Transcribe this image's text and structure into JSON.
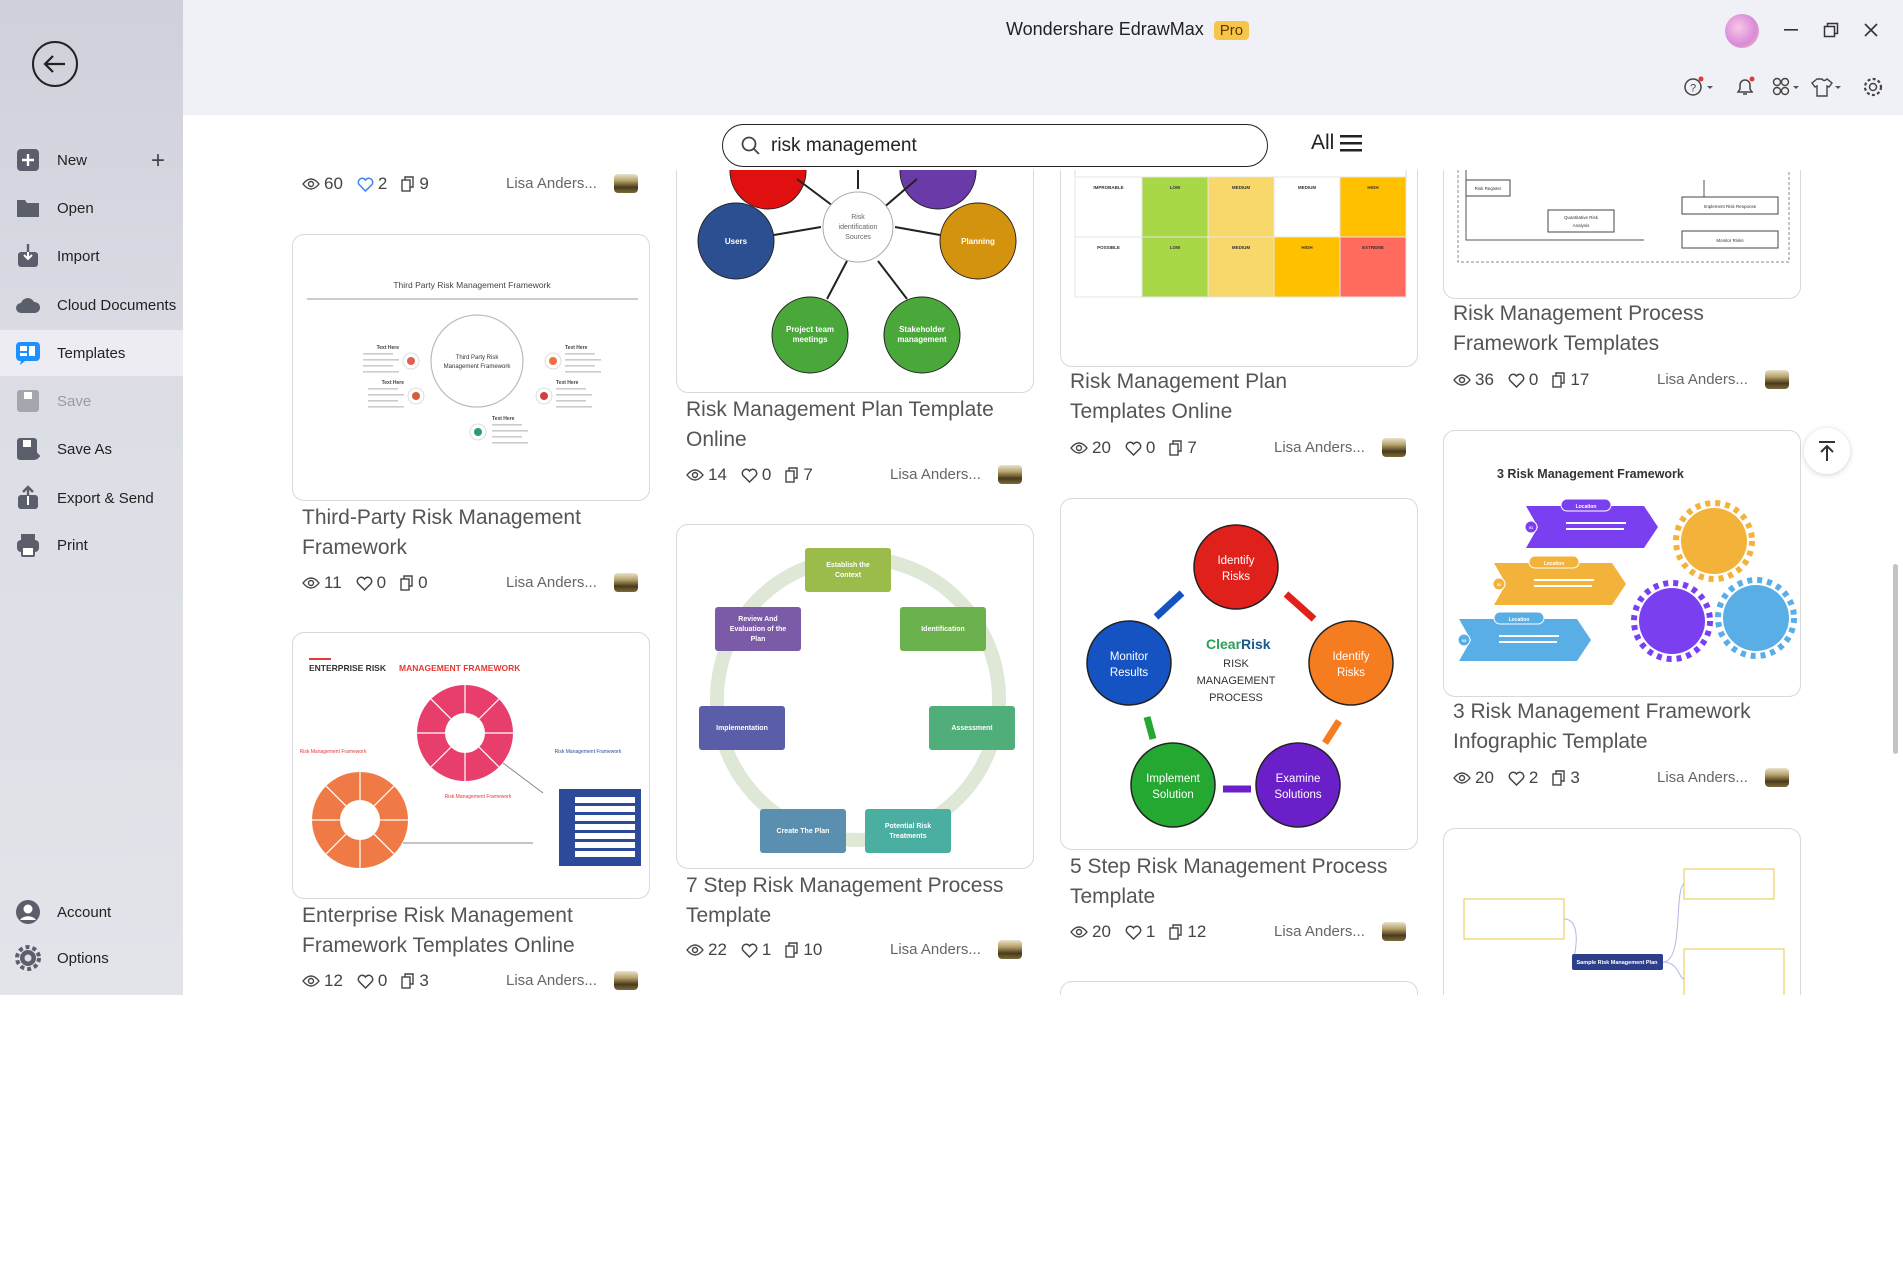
{
  "app": {
    "title": "Wondershare EdrawMax",
    "badge": "Pro"
  },
  "header_icons": [
    "avatar",
    "minimize-icon",
    "restore-icon",
    "close-icon",
    "help-icon",
    "bell-icon",
    "apps-icon",
    "shirt-icon",
    "gear-icon"
  ],
  "sidebar": {
    "items": [
      {
        "label": "New",
        "icon": "plus-square-icon"
      },
      {
        "label": "Open",
        "icon": "folder-icon"
      },
      {
        "label": "Import",
        "icon": "import-icon"
      },
      {
        "label": "Cloud Documents",
        "icon": "cloud-icon"
      },
      {
        "label": "Templates",
        "icon": "templates-icon",
        "selected": true
      },
      {
        "label": "Save",
        "icon": "save-icon",
        "disabled": true
      },
      {
        "label": "Save As",
        "icon": "save-as-icon"
      },
      {
        "label": "Export & Send",
        "icon": "export-icon"
      },
      {
        "label": "Print",
        "icon": "print-icon"
      }
    ],
    "bottom": [
      {
        "label": "Account",
        "icon": "account-icon"
      },
      {
        "label": "Options",
        "icon": "options-gear-icon"
      }
    ]
  },
  "search": {
    "value": "risk management",
    "filter_label": "All"
  },
  "colors": {
    "liked": "#3b82f6",
    "accent_badge": "#f7c54a"
  },
  "cards": [
    {
      "title_lines": [],
      "views": "60",
      "likes": "2",
      "liked": true,
      "copies": "9",
      "author": "Lisa Anders..."
    },
    {
      "title_lines": [
        "Third-Party Risk Management",
        "Framework"
      ],
      "views": "11",
      "likes": "0",
      "copies": "0",
      "author": "Lisa Anders...",
      "thumb_text": {
        "heading": "Third Party Risk Management Framework",
        "center1": "Third Party Risk",
        "center2": "Management Framework",
        "item": "Text Here"
      }
    },
    {
      "title_lines": [
        "Enterprise Risk Management",
        "Framework Templates Online"
      ],
      "views": "12",
      "likes": "0",
      "copies": "3",
      "author": "Lisa Anders...",
      "thumb_text": {
        "heading_a": "ENTERPRISE RISK ",
        "heading_b": "MANAGEMENT FRAMEWORK",
        "left": "Risk Management Framework",
        "mid": "Risk Management Framework",
        "right": "Risk Management Framework"
      }
    },
    {
      "title_lines": [
        "Risk Management Plan Template",
        "Online"
      ],
      "views": "14",
      "likes": "0",
      "copies": "7",
      "author": "Lisa Anders...",
      "thumb_text": {
        "center1": "Risk",
        "center2": "identification",
        "center3": "Sources",
        "users": "Users",
        "planning": "Planning",
        "team1": "Project team",
        "team2": "meetings",
        "stake1": "Stakeholder",
        "stake2": "management"
      }
    },
    {
      "title_lines": [
        "7 Step Risk Management Process",
        "Template"
      ],
      "views": "22",
      "likes": "1",
      "copies": "10",
      "author": "Lisa Anders...",
      "thumb_text": {
        "steps": [
          [
            "Establish the",
            "Context"
          ],
          [
            "Identification"
          ],
          [
            "Assessment"
          ],
          [
            "Potential Risk",
            "Treatments"
          ],
          [
            "Create The Plan"
          ],
          [
            "Implementation"
          ],
          [
            "Review And",
            "Evaluation of the",
            "Plan"
          ]
        ]
      }
    },
    {
      "title_lines": [
        "Risk Management Plan",
        "Templates Online"
      ],
      "views": "20",
      "likes": "0",
      "copies": "7",
      "author": "Lisa Anders...",
      "thumb_text": {
        "rows": [
          [
            "IMPROBABLE",
            "LOW",
            "MEDIUM",
            "MEDIUM",
            "HIGH"
          ],
          [
            "POSSIBLE",
            "LOW",
            "MEDIUM",
            "HIGH",
            "EXTREME"
          ]
        ]
      }
    },
    {
      "title_lines": [
        "5 Step Risk Management Process",
        "Template"
      ],
      "views": "20",
      "likes": "1",
      "copies": "12",
      "author": "Lisa Anders...",
      "thumb_text": {
        "brand_a": "Clear",
        "brand_b": "Risk",
        "c1": "RISK",
        "c2": "MANAGEMENT",
        "c3": "PROCESS",
        "steps": [
          [
            "Identify",
            "Risks"
          ],
          [
            "Identify",
            "Risks"
          ],
          [
            "Examine",
            "Solutions"
          ],
          [
            "Implement",
            "Solution"
          ],
          [
            "Monitor",
            "Results"
          ]
        ]
      }
    },
    {
      "title_lines": []
    },
    {
      "title_lines": [
        "Risk Management Process",
        "Framework Templates"
      ],
      "views": "36",
      "likes": "0",
      "copies": "17",
      "author": "Lisa Anders...",
      "thumb_text": {
        "b1": "Risk Register",
        "b2a": "Quantitative Risk",
        "b2b": "Analysis",
        "b3": "Implement Risk Response",
        "b4": "Monitor Risks"
      }
    },
    {
      "title_lines": [
        "3 Risk Management Framework",
        "Infographic Template"
      ],
      "views": "20",
      "likes": "2",
      "copies": "3",
      "author": "Lisa Anders...",
      "thumb_text": {
        "heading": "3 Risk Management Framework",
        "pill": "Location",
        "num": [
          "01",
          "02",
          "03"
        ]
      }
    },
    {
      "title_lines": [],
      "thumb_text": {
        "center": "Sample Risk Management Plan"
      }
    }
  ]
}
